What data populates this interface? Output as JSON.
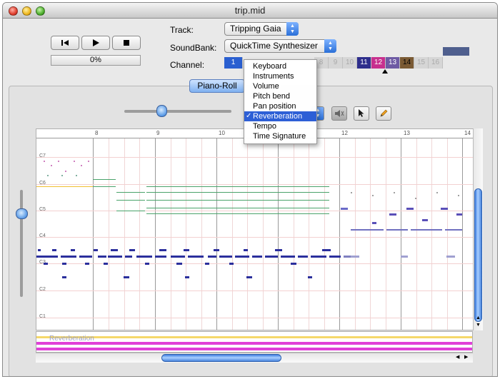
{
  "window": {
    "title": "trip.mid"
  },
  "transport": {
    "rewind_icon": "skip-to-start-icon",
    "play_icon": "play-icon",
    "stop_icon": "stop-icon",
    "progress_text": "0%",
    "progress_value": 0
  },
  "fields": {
    "track_label": "Track:",
    "track_value": "Tripping Gaia",
    "soundbank_label": "SoundBank:",
    "soundbank_value": "QuickTime Synthesizer",
    "channel_label": "Channel:"
  },
  "channels": [
    {
      "num": "1",
      "color": "#2a5fd0",
      "active": true
    },
    {
      "num": "8",
      "color": "#d6d6d6",
      "active": false
    },
    {
      "num": "9",
      "color": "#d6d6d6",
      "active": false
    },
    {
      "num": "10",
      "color": "#d6d6d6",
      "active": false
    },
    {
      "num": "11",
      "color": "#2e2e8c",
      "active": true
    },
    {
      "num": "12",
      "color": "#c7308e",
      "active": true
    },
    {
      "num": "13",
      "color": "#6e5aa4",
      "active": true
    },
    {
      "num": "14",
      "color": "#7a5a34",
      "active": true
    },
    {
      "num": "15",
      "color": "#d6d6d6",
      "active": false
    },
    {
      "num": "16",
      "color": "#d6d6d6",
      "active": false
    }
  ],
  "view_tab": {
    "label": "Piano-Roll"
  },
  "tools": {
    "speaker_icon": "speaker-icon",
    "arrow_icon": "arrow-pointer-icon",
    "pencil_icon": "pencil-icon"
  },
  "ruler": {
    "marks": [
      "8",
      "9",
      "10",
      "12",
      "13",
      "14"
    ]
  },
  "octaves": [
    "C7",
    "C6",
    "C5",
    "C4",
    "C3",
    "C2",
    "C1"
  ],
  "controller_lane": {
    "label": "Reverberation"
  },
  "menu": {
    "items": [
      "Keyboard",
      "Instruments",
      "Volume",
      "Pitch bend",
      "Pan position",
      "Reverberation",
      "Tempo",
      "Time Signature"
    ],
    "selected": "Reverberation",
    "check_glyph": "✓"
  },
  "colors": {
    "note_blue": "#2b2f9c",
    "note_green": "#4aa36a",
    "lane_magenta": "#e040d8",
    "lane_yellow": "#f5d86a",
    "accent": "#2d5fd6"
  }
}
